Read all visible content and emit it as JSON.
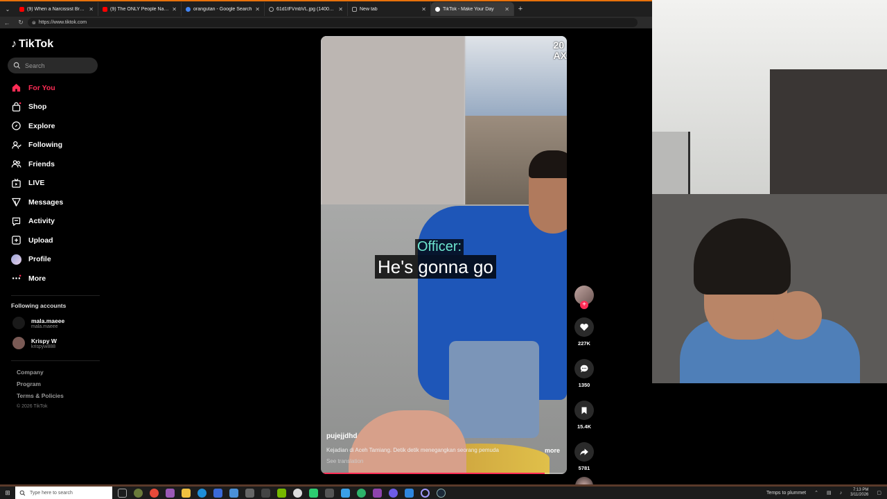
{
  "browser": {
    "tabs": [
      {
        "label": "(9) When a Narcissist Breaks the S",
        "favicon_color": "#ff0000",
        "active": false
      },
      {
        "label": "(9) The ONLY People Narcissists St",
        "favicon_color": "#ff0000",
        "active": false
      },
      {
        "label": "orangutan - Google Search",
        "favicon_color": "#4285f4",
        "active": false
      },
      {
        "label": "61d1tFVmbVL.jpg (1400×1404)",
        "favicon_color": "#888888",
        "active": false
      },
      {
        "label": "New tab",
        "favicon_color": "#888888",
        "active": false
      },
      {
        "label": "TikTok - Make Your Day",
        "favicon_color": "#ffffff",
        "active": true
      }
    ],
    "url": "https://www.tiktok.com"
  },
  "tiktok": {
    "logo_text": "TikTok",
    "search_placeholder": "Search",
    "nav": [
      {
        "label": "For You",
        "icon": "home-icon",
        "active": true
      },
      {
        "label": "Shop",
        "icon": "shopping-bag-icon",
        "active": false
      },
      {
        "label": "Explore",
        "icon": "compass-icon",
        "active": false
      },
      {
        "label": "Following",
        "icon": "user-follow-icon",
        "active": false
      },
      {
        "label": "Friends",
        "icon": "friends-icon",
        "active": false
      },
      {
        "label": "LIVE",
        "icon": "live-icon",
        "active": false
      },
      {
        "label": "Messages",
        "icon": "send-icon",
        "active": false
      },
      {
        "label": "Activity",
        "icon": "activity-icon",
        "active": false
      },
      {
        "label": "Upload",
        "icon": "plus-square-icon",
        "active": false
      },
      {
        "label": "Profile",
        "icon": "profile-avatar-icon",
        "active": false
      },
      {
        "label": "More",
        "icon": "more-icon",
        "active": false
      }
    ],
    "following_title": "Following accounts",
    "following": [
      {
        "name": "mala.maeee",
        "handle": "mala.maeee"
      },
      {
        "name": "Krispy W",
        "handle": "krispyw888"
      }
    ],
    "footer": [
      "Company",
      "Program",
      "Terms & Policies"
    ],
    "copyright": "© 2026 TikTok"
  },
  "video": {
    "watermark_line1": "20",
    "watermark_line2": "AX",
    "caption_speaker": "Officer:",
    "caption_text": "He's gonna go",
    "username": "pujejjdhd",
    "description": "Kejadian di Aceh Tamiang. Detik detik menegangkan seorang pemuda",
    "see_translation": "See translation",
    "more": "more",
    "progress": 0.91,
    "likes": "227K",
    "comments": "1350",
    "saves": "15.4K",
    "shares": "5781",
    "accent": "#fe2c55"
  },
  "taskbar": {
    "search_placeholder": "Type here to search",
    "weather": "Temps to plummet",
    "time": "7:13 PM",
    "date": "3/11/2026"
  }
}
